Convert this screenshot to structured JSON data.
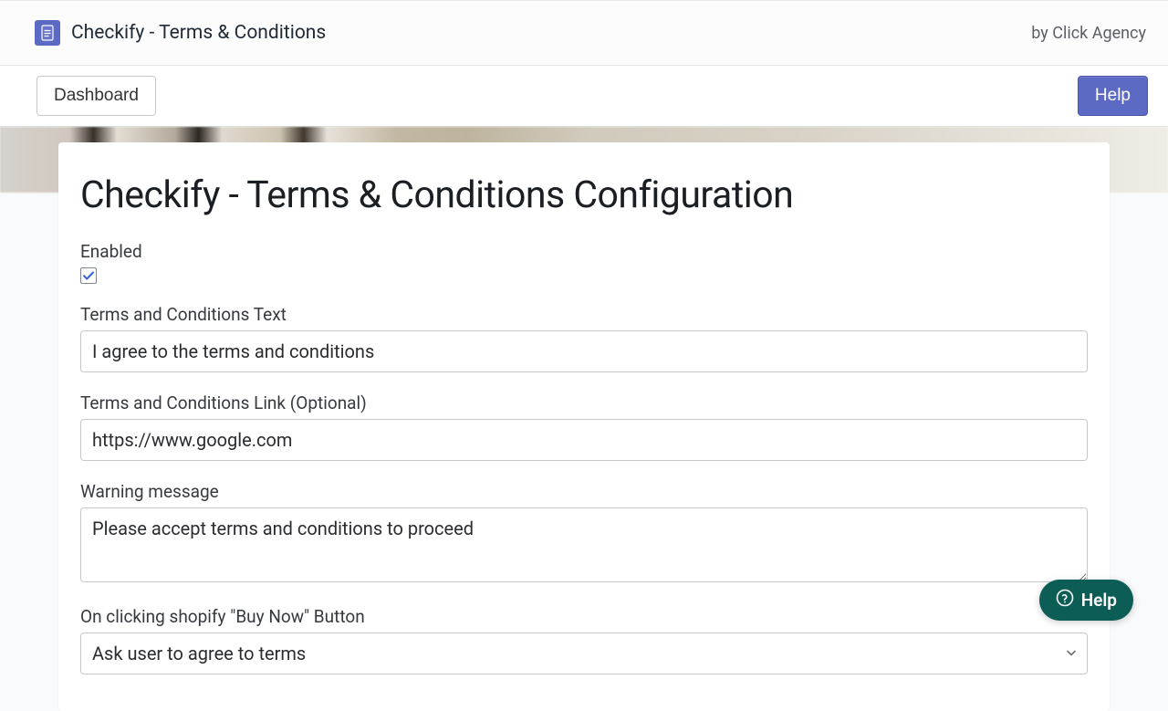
{
  "header": {
    "app_title": "Checkify - Terms & Conditions",
    "byline": "by Click Agency"
  },
  "nav": {
    "dashboard_label": "Dashboard",
    "help_label": "Help"
  },
  "page": {
    "title": "Checkify - Terms & Conditions Configuration"
  },
  "form": {
    "enabled": {
      "label": "Enabled",
      "checked": true
    },
    "terms_text": {
      "label": "Terms and Conditions Text",
      "value": "I agree to the terms and conditions"
    },
    "terms_link": {
      "label": "Terms and Conditions Link (Optional)",
      "value": "https://www.google.com"
    },
    "warning": {
      "label": "Warning message",
      "value": "Please accept terms and conditions to proceed"
    },
    "buy_now": {
      "label": "On clicking shopify \"Buy Now\" Button",
      "value": "Ask user to agree to terms"
    }
  },
  "fab": {
    "label": "Help"
  }
}
